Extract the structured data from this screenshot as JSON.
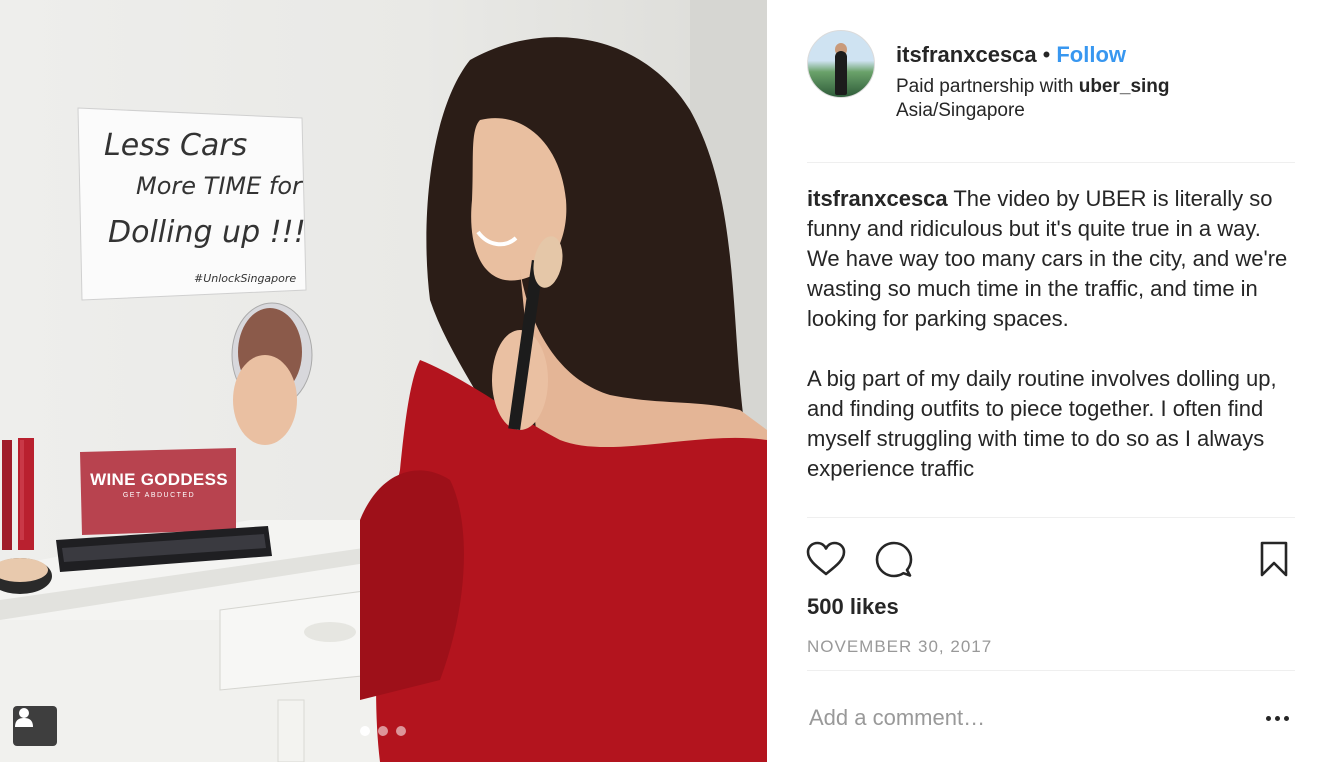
{
  "post": {
    "author": "itsfranxcesca",
    "separator": "•",
    "follow_label": "Follow",
    "paid_prefix": "Paid partnership with ",
    "partner": "uber_sing",
    "location": "Asia/Singapore"
  },
  "caption": {
    "username": "itsfranxcesca",
    "paragraph1": " The video by UBER is literally so funny and ridiculous but it's quite true in a way. We have way too many cars in the city, and we're wasting so much time in the traffic, and time in looking for parking spaces.",
    "paragraph2": "A big part of my daily routine involves dolling up, and finding outfits to piece together. I often find myself struggling with time to do so as I always experience traffic"
  },
  "photo": {
    "note_line1": "Less Cars",
    "note_line2": "More TIME for",
    "note_line3": "Dolling up !!!",
    "note_hashtag": "#UnlockSingapore",
    "palette_title": "WINE GODDESS",
    "palette_subtitle": "GET ABDUCTED",
    "carousel_count": 3,
    "carousel_active": 1
  },
  "stats": {
    "likes": "500 likes",
    "date": "NOVEMBER 30, 2017"
  },
  "comment": {
    "placeholder": "Add a comment…"
  },
  "icons": {
    "like": "heart-icon",
    "comment": "speech-bubble-icon",
    "save": "bookmark-icon",
    "more": "more-options-icon",
    "tagged": "tagged-user-icon"
  },
  "colors": {
    "link": "#3897f0",
    "text": "#262626",
    "muted": "#999999",
    "divider": "#efefef"
  }
}
